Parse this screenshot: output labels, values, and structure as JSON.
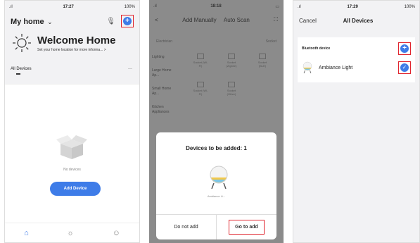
{
  "screen1": {
    "status_time": "17:27",
    "status_batt": "100%",
    "home_title": "My home",
    "dropdown_caret": "⌄",
    "mic_icon": "mic-icon",
    "welcome_title": "Welcome Home",
    "welcome_sub": "Set your home location for more informa...",
    "welcome_arrow": ">",
    "all_devices": "All Devices",
    "more": "···",
    "no_devices": "No devices",
    "add_device": "Add Device",
    "tabs": [
      {
        "icon": "home-icon",
        "glyph": "⌂"
      },
      {
        "icon": "sun-icon",
        "glyph": "☼"
      },
      {
        "icon": "profile-icon",
        "glyph": "☺"
      }
    ]
  },
  "screen2": {
    "status_time": "18:18",
    "back": "<",
    "tab_manual": "Add Manually",
    "tab_auto": "Auto Scan",
    "scan_icon": "⛶",
    "col_left": "Electrician",
    "col_right": "Socket",
    "categories": [
      "Lighting",
      "Large Home Ap...",
      "Small Home Ap...",
      "Kitchen Appliances"
    ],
    "grid_labels": [
      "Socket (Wi-Fi)",
      "Socket (Zigbee)",
      "Socket (BLE)",
      "Socket (Wi-Fi)",
      "Socket (Other)"
    ],
    "modal_title": "Devices to be added: 1",
    "modal_device": "Ambiance Li...",
    "btn_no": "Do not add",
    "btn_go": "Go to add"
  },
  "screen3": {
    "status_time": "17:29",
    "status_batt": "100%",
    "cancel": "Cancel",
    "title": "All Devices",
    "section": "Bluetooth device",
    "device_name": "Ambiance Light"
  },
  "colors": {
    "accent": "#3e7ce8",
    "highlight": "#e0242e"
  }
}
